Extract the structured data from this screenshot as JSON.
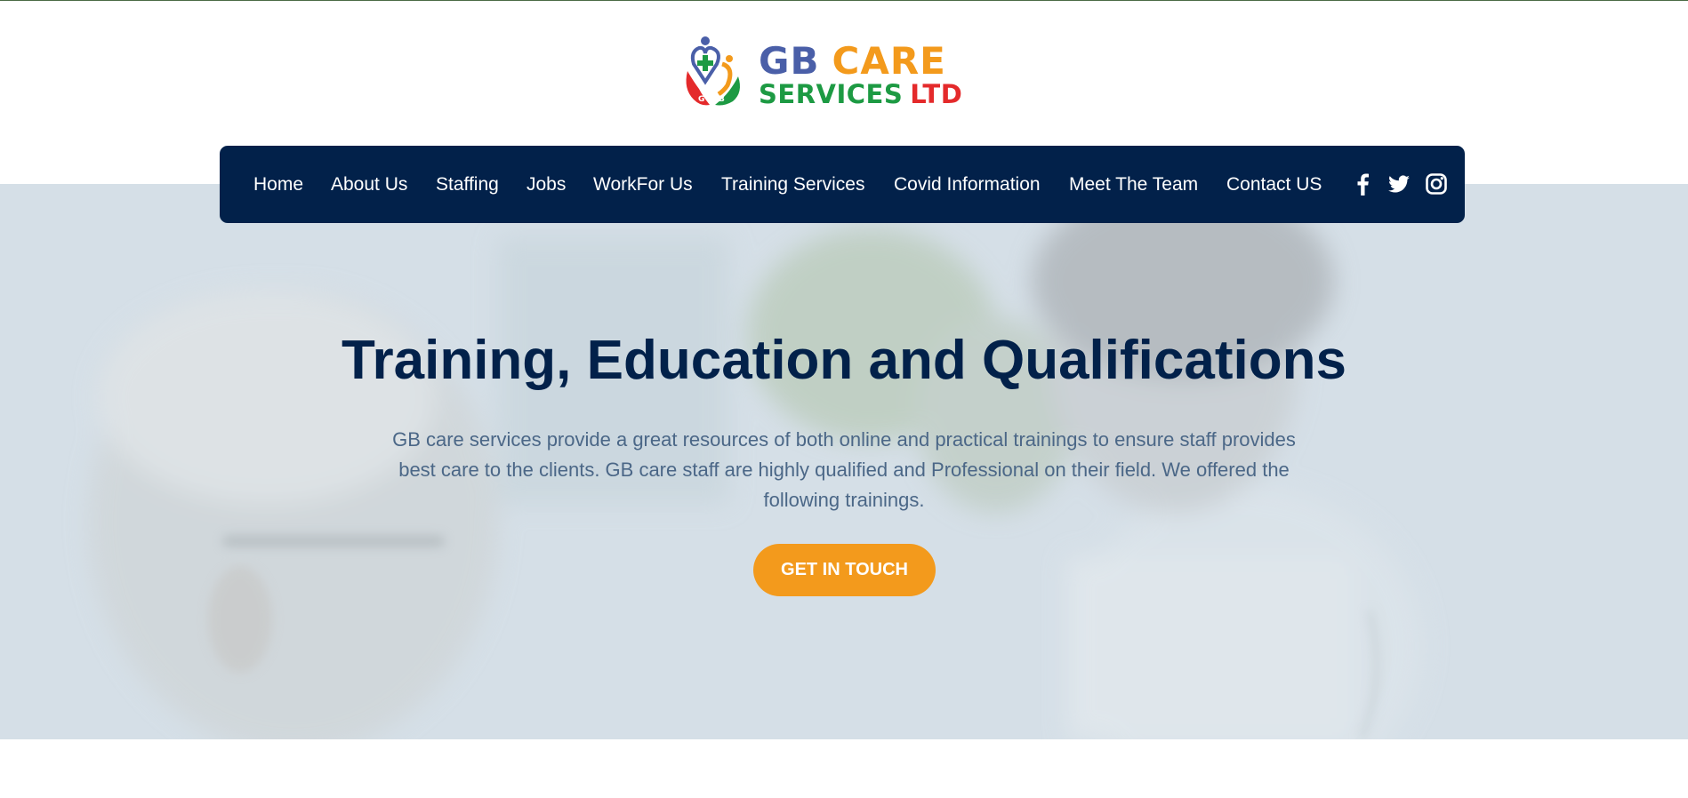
{
  "brand": {
    "logo_line1_part1": "GB",
    "logo_line1_part2": "CARE",
    "logo_line2_part1": "SERVICES",
    "logo_line2_part2": "LTD",
    "logo_mark_letters": [
      "G",
      "B"
    ],
    "colors": {
      "blue": "#4a5fa8",
      "orange": "#f39a1c",
      "green": "#1d9a43",
      "red": "#e42a2b"
    }
  },
  "nav": {
    "items": [
      {
        "label": "Home"
      },
      {
        "label": "About Us"
      },
      {
        "label": "Staffing"
      },
      {
        "label": "Jobs"
      },
      {
        "label": "WorkFor Us"
      },
      {
        "label": "Training Services"
      },
      {
        "label": "Covid Information"
      },
      {
        "label": "Meet The Team"
      },
      {
        "label": "Contact US"
      }
    ],
    "social": [
      "facebook-icon",
      "twitter-icon",
      "instagram-icon"
    ],
    "background": "#02214a"
  },
  "hero": {
    "title": "Training, Education and Qualifications",
    "description": "GB care services provide a great resources of both online and practical trainings to ensure staff provides best care to the clients. GB care staff are highly qualified and Professional on their field. We offered the following trainings.",
    "cta_label": "GET IN TOUCH",
    "title_color": "#02214a",
    "cta_color": "#f39a1c"
  }
}
